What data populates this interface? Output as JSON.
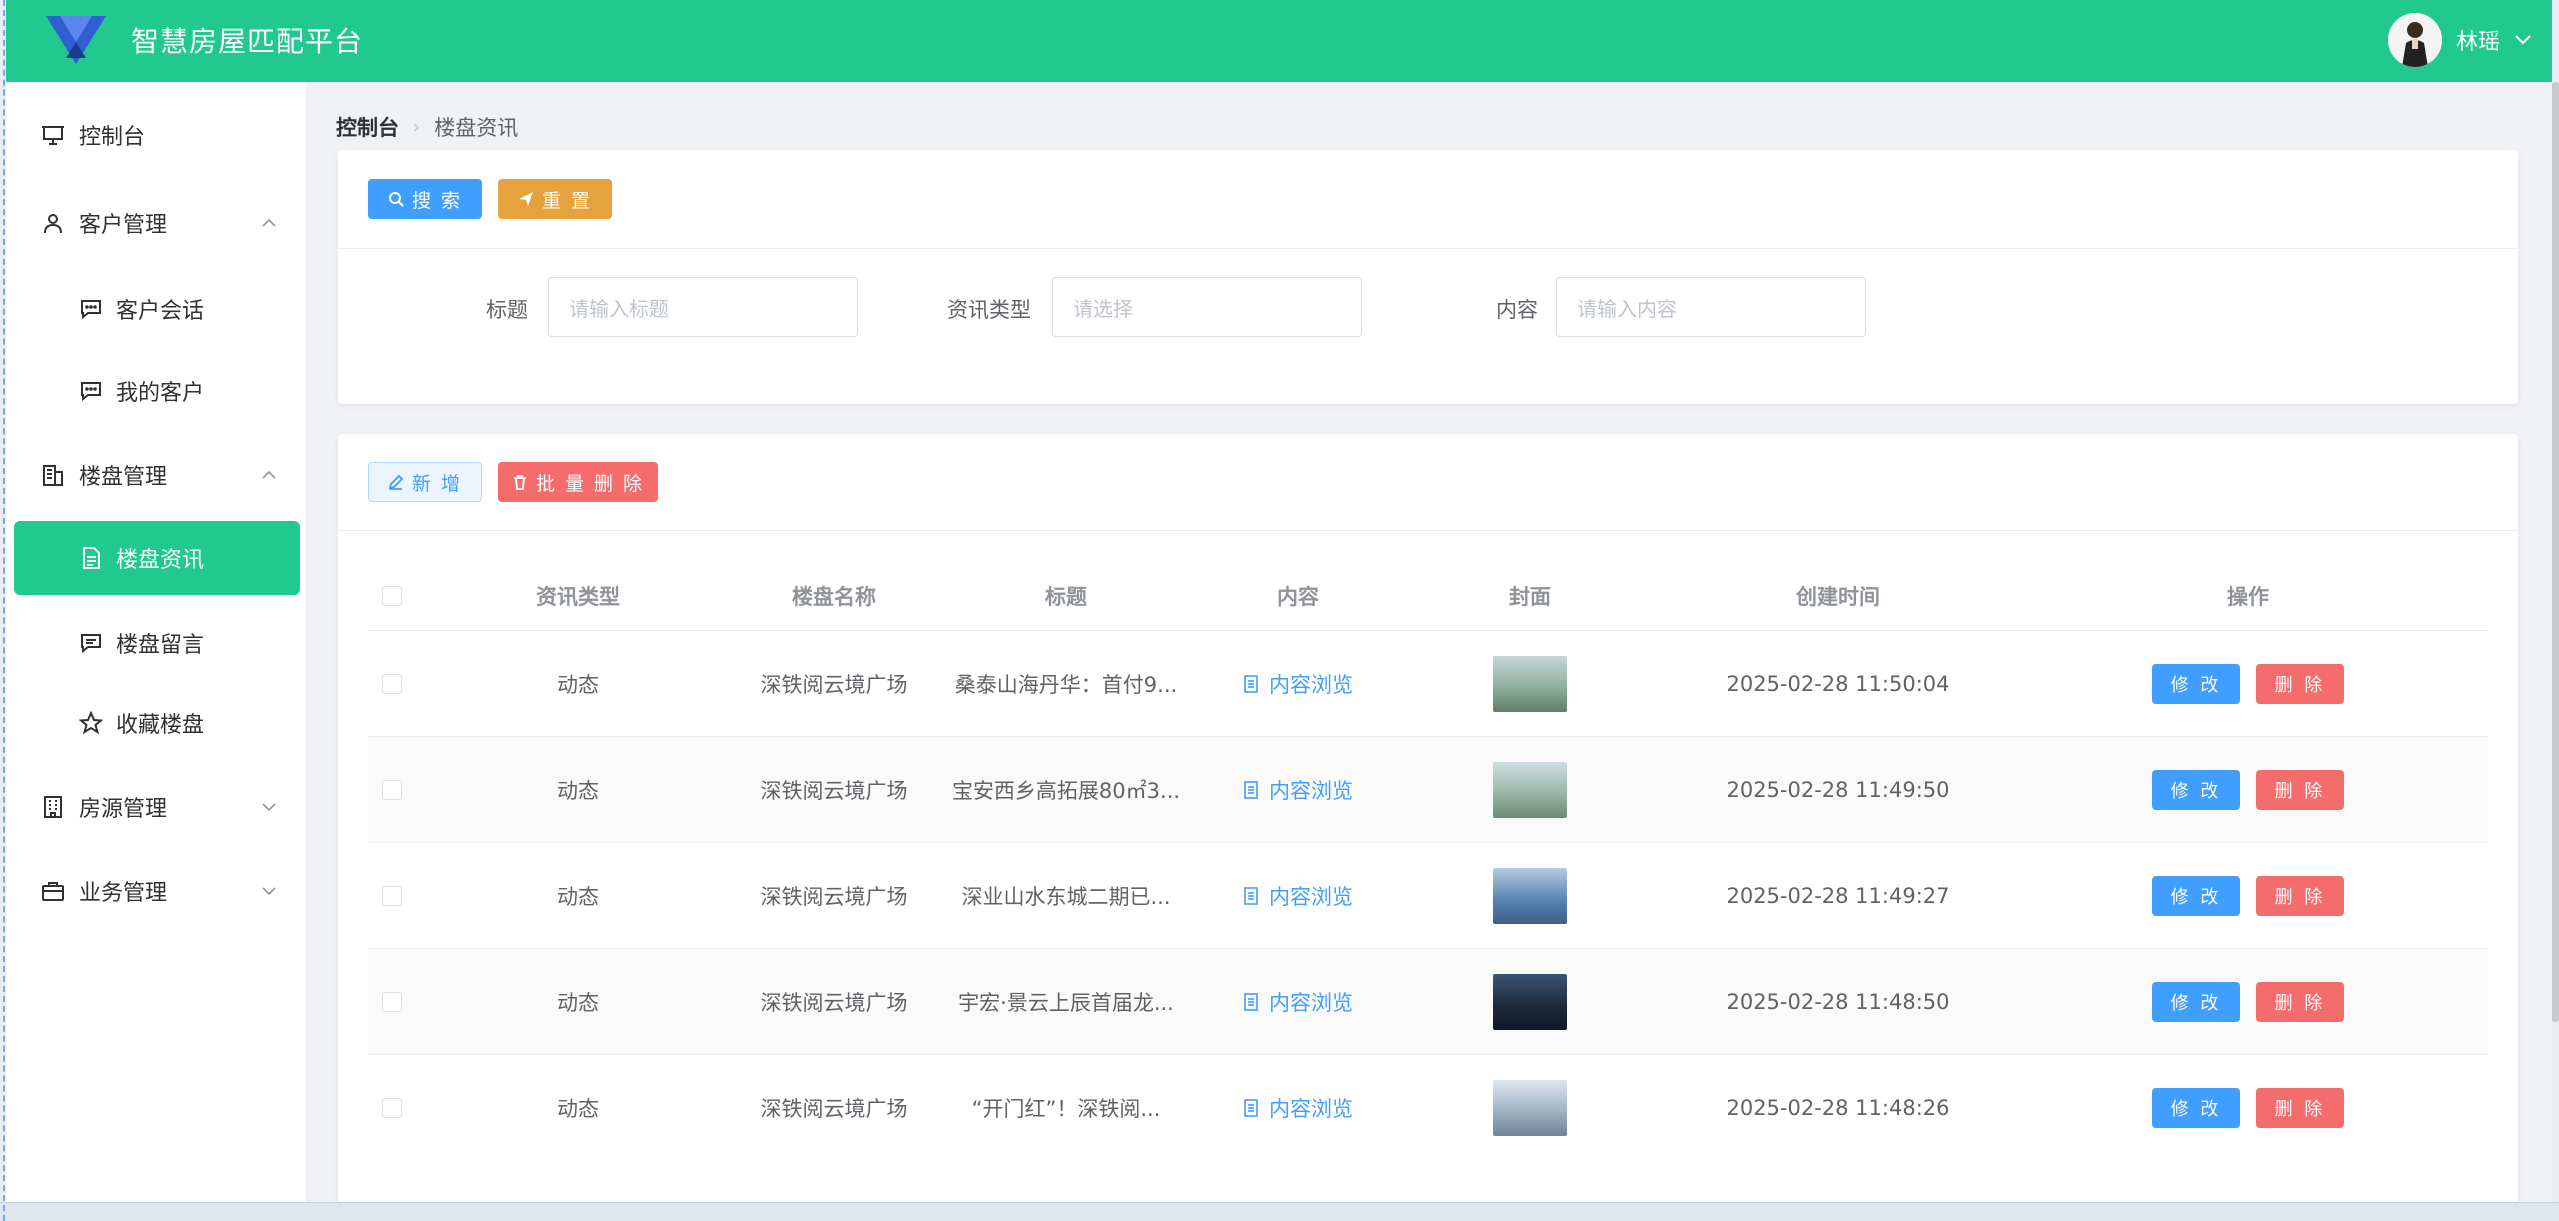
{
  "app": {
    "title": "智慧房屋匹配平台",
    "user_name": "林瑶"
  },
  "sidebar": {
    "items": [
      {
        "label": "控制台",
        "icon": "presentation-icon"
      },
      {
        "label": "客户管理",
        "icon": "user-icon",
        "expanded": true
      },
      {
        "label": "客户会话",
        "icon": "chat-icon"
      },
      {
        "label": "我的客户",
        "icon": "chat-icon"
      },
      {
        "label": "楼盘管理",
        "icon": "building-icon",
        "expanded": true
      },
      {
        "label": "楼盘资讯",
        "icon": "document-icon",
        "active": true
      },
      {
        "label": "楼盘留言",
        "icon": "message-icon"
      },
      {
        "label": "收藏楼盘",
        "icon": "star-icon"
      },
      {
        "label": "房源管理",
        "icon": "office-icon",
        "expanded": false
      },
      {
        "label": "业务管理",
        "icon": "briefcase-icon",
        "expanded": false
      }
    ]
  },
  "breadcrumb": {
    "home": "控制台",
    "current": "楼盘资讯"
  },
  "search": {
    "search_button": "搜 索",
    "reset_button": "重 置",
    "fields": [
      {
        "label": "标题",
        "placeholder": "请输入标题"
      },
      {
        "label": "资讯类型",
        "placeholder": "请选择"
      },
      {
        "label": "内容",
        "placeholder": "请输入内容"
      }
    ]
  },
  "toolbar": {
    "add_button": "新 增",
    "batch_delete_button": "批 量 删 除"
  },
  "table": {
    "headers": [
      "资讯类型",
      "楼盘名称",
      "标题",
      "内容",
      "封面",
      "创建时间",
      "操作"
    ],
    "rows": [
      {
        "type": "动态",
        "estate": "深铁阅云境广场",
        "title": "桑泰山海丹华：首付9...",
        "content": "内容浏览",
        "created": "2025-02-28 11:50:04",
        "cover_colors": [
          "#8fb0a0",
          "#c9d6d8",
          "#5f7d6a"
        ]
      },
      {
        "type": "动态",
        "estate": "深铁阅云境广场",
        "title": "宝安西乡高拓展80㎡3...",
        "content": "内容浏览",
        "created": "2025-02-28 11:49:50",
        "cover_colors": [
          "#9ab7a8",
          "#cfdde0",
          "#6b8a73"
        ]
      },
      {
        "type": "动态",
        "estate": "深铁阅云境广场",
        "title": "深业山水东城二期已...",
        "content": "内容浏览",
        "created": "2025-02-28 11:49:27",
        "cover_colors": [
          "#5a86b5",
          "#b7cbe0",
          "#3e5e86"
        ]
      },
      {
        "type": "动态",
        "estate": "深铁阅云境广场",
        "title": "宇宏·景云上辰首届龙...",
        "content": "内容浏览",
        "created": "2025-02-28 11:48:50",
        "cover_colors": [
          "#1d2b3c",
          "#3b5573",
          "#0f1826"
        ]
      },
      {
        "type": "动态",
        "estate": "深铁阅云境广场",
        "title": "“开门红”！深铁阅...",
        "content": "内容浏览",
        "created": "2025-02-28 11:48:26",
        "cover_colors": [
          "#9fb3c4",
          "#dfe7ee",
          "#6f8396"
        ]
      }
    ],
    "edit_label": "修 改",
    "delete_label": "删 除"
  },
  "colors": {
    "brand": "#22c98e",
    "primary": "#409eff",
    "danger": "#f56c6c",
    "warning": "#e6a23c"
  }
}
